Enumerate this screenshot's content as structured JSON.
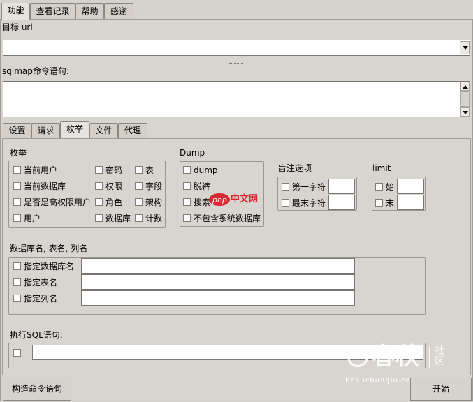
{
  "top_tabs": [
    "功能",
    "查看记录",
    "帮助",
    "感谢"
  ],
  "target_url": {
    "label": "目标 url",
    "value": ""
  },
  "sqlmap_cmd": {
    "label": "sqlmap命令语句:",
    "value": ""
  },
  "inner_tabs": [
    "设置",
    "请求",
    "枚举",
    "文件",
    "代理"
  ],
  "enum": {
    "title": "枚举",
    "col1": [
      "当前用户",
      "当前数据库",
      "是否是高权限用户",
      "用户"
    ],
    "col2": [
      "密码",
      "权限",
      "角色",
      "数据库"
    ],
    "col3": [
      "表",
      "字段",
      "架构",
      "计数"
    ]
  },
  "dump": {
    "title": "Dump",
    "items": [
      "dump",
      "脱裤",
      "搜索",
      "不包含系统数据库"
    ]
  },
  "blind": {
    "title": "盲注选项",
    "items": [
      "第一字符",
      "最末字符"
    ]
  },
  "limit": {
    "title": "limit",
    "items": [
      "始",
      "末"
    ]
  },
  "names": {
    "title": "数据库名, 表名, 列名",
    "items": [
      "指定数据库名",
      "指定表名",
      "指定列名"
    ]
  },
  "sql": {
    "title": "执行SQL语句:"
  },
  "buttons": {
    "build": "构造命令语句",
    "start": "开始"
  },
  "watermarks": {
    "php": "php",
    "php_cn": "中文网",
    "logo_main": "春秋",
    "logo_side": "社区",
    "logo_url": "bbs.ichunqiu.com"
  }
}
